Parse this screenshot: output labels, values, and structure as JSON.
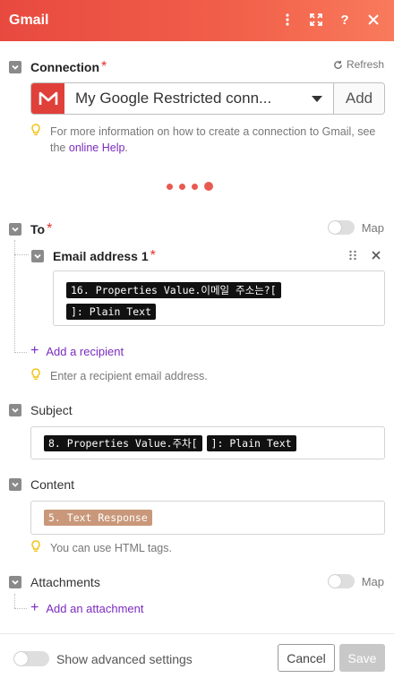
{
  "header": {
    "title": "Gmail"
  },
  "connection": {
    "label": "Connection",
    "required_mark": "*",
    "refresh_label": "Refresh",
    "selected": "My Google Restricted conn...",
    "add_label": "Add",
    "hint_text": "For more information on how to create a connection to Gmail, see the",
    "hint_link": "online Help",
    "hint_end": "."
  },
  "to": {
    "label": "To",
    "required_mark": "*",
    "map_label": "Map",
    "email_item": {
      "label": "Email address 1",
      "required_mark": "*",
      "pill_1": "16. Properties Value.이메일 주소는?[",
      "pill_2": "]: Plain Text"
    },
    "add_recipient": "Add a recipient",
    "hint": "Enter a recipient email address."
  },
  "subject": {
    "label": "Subject",
    "pill_1": "8. Properties Value.주차[",
    "pill_2": "]: Plain Text"
  },
  "content": {
    "label": "Content",
    "pill_1": "5. Text Response",
    "hint": "You can use HTML tags."
  },
  "attachments": {
    "label": "Attachments",
    "map_label": "Map",
    "add_attachment": "Add an attachment"
  },
  "footer": {
    "advanced_label": "Show advanced settings",
    "cancel_label": "Cancel",
    "save_label": "Save"
  },
  "colors": {
    "header_start": "#e8493f",
    "header_end": "#f97a5c",
    "link": "#7b2bbf",
    "required": "#e0322b",
    "loader": "#e85a4f"
  }
}
